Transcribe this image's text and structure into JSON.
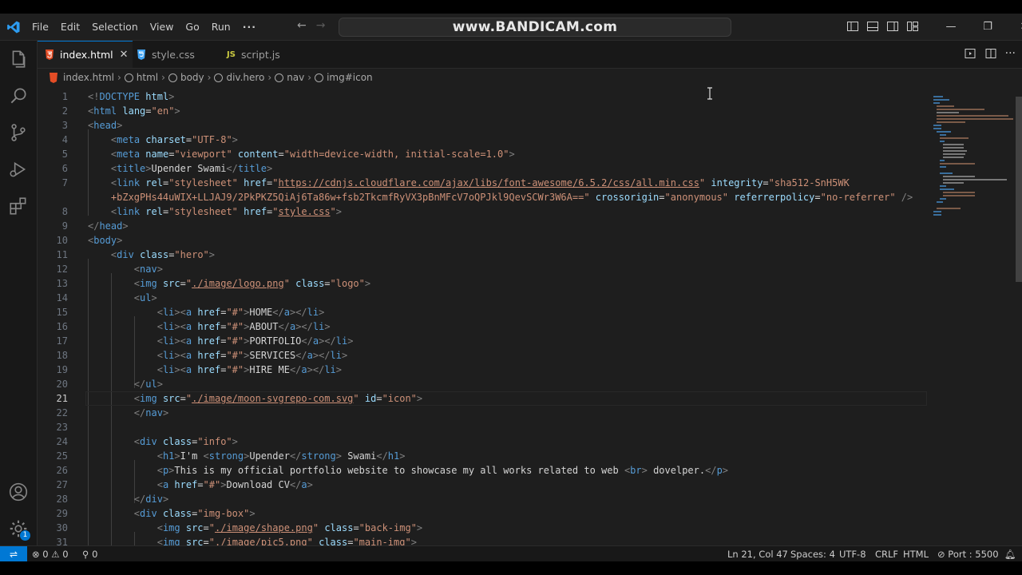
{
  "titlebar": {
    "menu": [
      "File",
      "Edit",
      "Selection",
      "View",
      "Go",
      "Run"
    ],
    "menu_more": "···",
    "command_center": "www.BANDICAM.com"
  },
  "tabs": [
    {
      "label": "index.html",
      "icon": "html5-icon",
      "icon_color": "#e44d26",
      "active": true
    },
    {
      "label": "style.css",
      "icon": "css-icon",
      "icon_color": "#42a5f5",
      "active": false
    },
    {
      "label": "script.js",
      "icon": "js-icon",
      "icon_text": "JS",
      "icon_color": "#cbcb41",
      "active": false
    }
  ],
  "breadcrumb": [
    "index.html",
    "html",
    "body",
    "div.hero",
    "nav",
    "img#icon"
  ],
  "editor": {
    "current_line": 21,
    "lines": [
      {
        "n": "1",
        "html": "<span class='p'>&lt;!</span><span class='t'>DOCTYPE</span> <span class='a'>html</span><span class='p'>&gt;</span>"
      },
      {
        "n": "2",
        "html": "<span class='p'>&lt;</span><span class='t'>html</span> <span class='a'>lang</span><span class='w'>=</span><span class='s'>\"en\"</span><span class='p'>&gt;</span>"
      },
      {
        "n": "3",
        "html": "<span class='p'>&lt;</span><span class='t'>head</span><span class='p'>&gt;</span>"
      },
      {
        "n": "4",
        "html": "    <span class='p'>&lt;</span><span class='t'>meta</span> <span class='a'>charset</span><span class='w'>=</span><span class='s'>\"UTF-8\"</span><span class='p'>&gt;</span>"
      },
      {
        "n": "5",
        "html": "    <span class='p'>&lt;</span><span class='t'>meta</span> <span class='a'>name</span><span class='w'>=</span><span class='s'>\"viewport\"</span> <span class='a'>content</span><span class='w'>=</span><span class='s'>\"width=device-width, initial-scale=1.0\"</span><span class='p'>&gt;</span>"
      },
      {
        "n": "6",
        "html": "    <span class='p'>&lt;</span><span class='t'>title</span><span class='p'>&gt;</span><span class='w'>Upender Swami</span><span class='p'>&lt;/</span><span class='t'>title</span><span class='p'>&gt;</span>"
      },
      {
        "n": "7",
        "html": "    <span class='p'>&lt;</span><span class='t'>link</span> <span class='a'>rel</span><span class='w'>=</span><span class='s'>\"stylesheet\"</span> <span class='a'>href</span><span class='w'>=</span><span class='s'>\"</span><span class='u'>https://cdnjs.cloudflare.com/ajax/libs/font-awesome/6.5.2/css/all.min.css</span><span class='s'>\"</span> <span class='a'>integrity</span><span class='w'>=</span><span class='s'>\"sha512-SnH5WK</span>"
      },
      {
        "n": "",
        "html": "    <span class='s'>+bZxgPHs44uWIX+LLJAJ9/2PkPKZ5QiAj6Ta86w+fsb2TkcmfRyVX3pBnMFcV7oQPJkl9QevSCWr3W6A==\"</span> <span class='a'>crossorigin</span><span class='w'>=</span><span class='s'>\"anonymous\"</span> <span class='a'>referrerpolicy</span><span class='w'>=</span><span class='s'>\"no-referrer\"</span> <span class='p'>/&gt;</span>"
      },
      {
        "n": "8",
        "html": "    <span class='p'>&lt;</span><span class='t'>link</span> <span class='a'>rel</span><span class='w'>=</span><span class='s'>\"stylesheet\"</span> <span class='a'>href</span><span class='w'>=</span><span class='s'>\"</span><span class='u'>style.css</span><span class='s'>\"</span><span class='p'>&gt;</span>"
      },
      {
        "n": "9",
        "html": "<span class='p'>&lt;/</span><span class='t'>head</span><span class='p'>&gt;</span>"
      },
      {
        "n": "10",
        "html": "<span class='p'>&lt;</span><span class='t'>body</span><span class='p'>&gt;</span>"
      },
      {
        "n": "11",
        "html": "    <span class='p'>&lt;</span><span class='t'>div</span> <span class='a'>class</span><span class='w'>=</span><span class='s'>\"hero\"</span><span class='p'>&gt;</span>"
      },
      {
        "n": "12",
        "html": "        <span class='p'>&lt;</span><span class='t'>nav</span><span class='p'>&gt;</span>"
      },
      {
        "n": "13",
        "html": "        <span class='p'>&lt;</span><span class='t'>img</span> <span class='a'>src</span><span class='w'>=</span><span class='s'>\"</span><span class='u'>./image/logo.png</span><span class='s'>\"</span> <span class='a'>class</span><span class='w'>=</span><span class='s'>\"logo\"</span><span class='p'>&gt;</span>"
      },
      {
        "n": "14",
        "html": "        <span class='p'>&lt;</span><span class='t'>ul</span><span class='p'>&gt;</span>"
      },
      {
        "n": "15",
        "html": "            <span class='p'>&lt;</span><span class='t'>li</span><span class='p'>&gt;&lt;</span><span class='t'>a</span> <span class='a'>href</span><span class='w'>=</span><span class='s'>\"#\"</span><span class='p'>&gt;</span><span class='w'>HOME</span><span class='p'>&lt;/</span><span class='t'>a</span><span class='p'>&gt;&lt;/</span><span class='t'>li</span><span class='p'>&gt;</span>"
      },
      {
        "n": "16",
        "html": "            <span class='p'>&lt;</span><span class='t'>li</span><span class='p'>&gt;&lt;</span><span class='t'>a</span> <span class='a'>href</span><span class='w'>=</span><span class='s'>\"#\"</span><span class='p'>&gt;</span><span class='w'>ABOUT</span><span class='p'>&lt;/</span><span class='t'>a</span><span class='p'>&gt;&lt;/</span><span class='t'>li</span><span class='p'>&gt;</span>"
      },
      {
        "n": "17",
        "html": "            <span class='p'>&lt;</span><span class='t'>li</span><span class='p'>&gt;&lt;</span><span class='t'>a</span> <span class='a'>href</span><span class='w'>=</span><span class='s'>\"#\"</span><span class='p'>&gt;</span><span class='w'>PORTFOLIO</span><span class='p'>&lt;/</span><span class='t'>a</span><span class='p'>&gt;&lt;/</span><span class='t'>li</span><span class='p'>&gt;</span>"
      },
      {
        "n": "18",
        "html": "            <span class='p'>&lt;</span><span class='t'>li</span><span class='p'>&gt;&lt;</span><span class='t'>a</span> <span class='a'>href</span><span class='w'>=</span><span class='s'>\"#\"</span><span class='p'>&gt;</span><span class='w'>SERVICES</span><span class='p'>&lt;/</span><span class='t'>a</span><span class='p'>&gt;&lt;/</span><span class='t'>li</span><span class='p'>&gt;</span>"
      },
      {
        "n": "19",
        "html": "            <span class='p'>&lt;</span><span class='t'>li</span><span class='p'>&gt;&lt;</span><span class='t'>a</span> <span class='a'>href</span><span class='w'>=</span><span class='s'>\"#\"</span><span class='p'>&gt;</span><span class='w'>HIRE ME</span><span class='p'>&lt;/</span><span class='t'>a</span><span class='p'>&gt;&lt;/</span><span class='t'>li</span><span class='p'>&gt;</span>"
      },
      {
        "n": "20",
        "html": "        <span class='p'>&lt;/</span><span class='t'>ul</span><span class='p'>&gt;</span>"
      },
      {
        "n": "21",
        "html": "        <span class='p'>&lt;</span><span class='t'>img</span> <span class='a'>src</span><span class='w'>=</span><span class='s'>\"</span><span class='u'>./image/moon-svgrepo-com.svg</span><span class='s'>\"</span> <span class='a'>id</span><span class='w'>=</span><span class='s'>\"icon\"</span><span class='p'>&gt;</span>"
      },
      {
        "n": "22",
        "html": "        <span class='p'>&lt;/</span><span class='t'>nav</span><span class='p'>&gt;</span>"
      },
      {
        "n": "23",
        "html": ""
      },
      {
        "n": "24",
        "html": "        <span class='p'>&lt;</span><span class='t'>div</span> <span class='a'>class</span><span class='w'>=</span><span class='s'>\"info\"</span><span class='p'>&gt;</span>"
      },
      {
        "n": "25",
        "html": "            <span class='p'>&lt;</span><span class='t'>h1</span><span class='p'>&gt;</span><span class='w'>I'm </span><span class='p'>&lt;</span><span class='t'>strong</span><span class='p'>&gt;</span><span class='w'>Upender</span><span class='p'>&lt;/</span><span class='t'>strong</span><span class='p'>&gt;</span><span class='w'> Swami</span><span class='p'>&lt;/</span><span class='t'>h1</span><span class='p'>&gt;</span>"
      },
      {
        "n": "26",
        "html": "            <span class='p'>&lt;</span><span class='t'>p</span><span class='p'>&gt;</span><span class='w'>This is my official portfolio website to showcase my all works related to web </span><span class='p'>&lt;</span><span class='t'>br</span><span class='p'>&gt;</span><span class='w'> dovelper.</span><span class='p'>&lt;/</span><span class='t'>p</span><span class='p'>&gt;</span>"
      },
      {
        "n": "27",
        "html": "            <span class='p'>&lt;</span><span class='t'>a</span> <span class='a'>href</span><span class='w'>=</span><span class='s'>\"#\"</span><span class='p'>&gt;</span><span class='w'>Download CV</span><span class='p'>&lt;/</span><span class='t'>a</span><span class='p'>&gt;</span>"
      },
      {
        "n": "28",
        "html": "        <span class='p'>&lt;/</span><span class='t'>div</span><span class='p'>&gt;</span>"
      },
      {
        "n": "29",
        "html": "        <span class='p'>&lt;</span><span class='t'>div</span> <span class='a'>class</span><span class='w'>=</span><span class='s'>\"img-box\"</span><span class='p'>&gt;</span>"
      },
      {
        "n": "30",
        "html": "            <span class='p'>&lt;</span><span class='t'>img</span> <span class='a'>src</span><span class='w'>=</span><span class='s'>\"</span><span class='u'>./image/shape.png</span><span class='s'>\"</span> <span class='a'>class</span><span class='w'>=</span><span class='s'>\"back-img\"</span><span class='p'>&gt;</span>"
      },
      {
        "n": "31",
        "html": "            <span class='p'>&lt;</span><span class='t'>img</span> <span class='a'>src</span><span class='w'>=</span><span class='s'>\"</span><span class='u'>./image/pic5.png</span><span class='s'>\"</span> <span class='a'>class</span><span class='w'>=</span><span class='s'>\"main-img\"</span><span class='p'>&gt;</span>"
      }
    ]
  },
  "statusbar": {
    "errors": "0",
    "warnings": "0",
    "ports": "0",
    "position": "Ln 21, Col 47",
    "spaces": "Spaces: 4",
    "encoding": "UTF-8",
    "eol": "CRLF",
    "language": "HTML",
    "port": "Port : 5500"
  },
  "settings_badge": "1",
  "colors": {
    "accent": "#0078d4",
    "editor_bg": "#1e1e1e",
    "tag": "#569cd6",
    "attr": "#9cdcfe",
    "string": "#ce9178"
  }
}
